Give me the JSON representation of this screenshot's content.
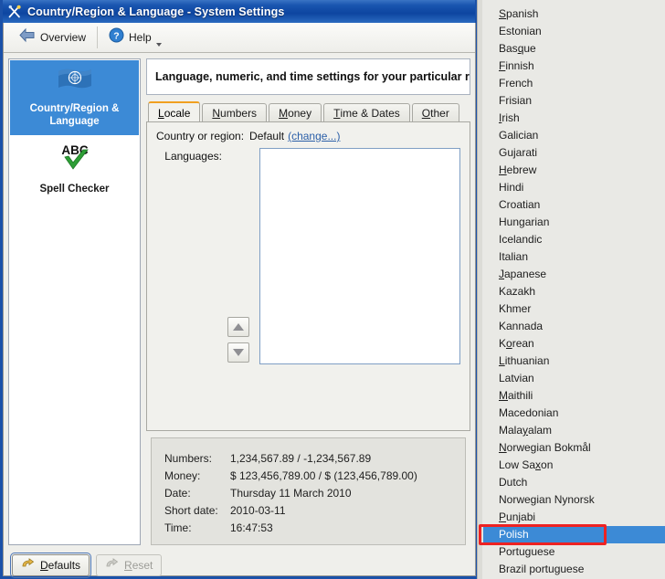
{
  "window": {
    "title": "Country/Region & Language - System Settings",
    "icon": "tools-icon"
  },
  "toolbar": {
    "overview_label_pre": "",
    "overview_label": "Overview",
    "overview_icon": "back-arrow-icon",
    "help_label": "Help",
    "help_icon": "help-circle-icon"
  },
  "sidebar": {
    "items": [
      {
        "label_line1": "Country/Region &",
        "label_line2": "Language",
        "icon": "un-flag-icon",
        "selected": true
      },
      {
        "label_line1": "Spell Checker",
        "label_line2": "",
        "icon": "abc-check-icon",
        "selected": false
      }
    ]
  },
  "main": {
    "header": "Language, numeric, and time settings for your particular region",
    "tabs": [
      {
        "label": "Locale",
        "mnemonic": "L",
        "active": true
      },
      {
        "label": "Numbers",
        "mnemonic": "N",
        "active": false
      },
      {
        "label": "Money",
        "mnemonic": "M",
        "active": false
      },
      {
        "label": "Time & Dates",
        "mnemonic": "T",
        "active": false
      },
      {
        "label": "Other",
        "mnemonic": "O",
        "active": false
      }
    ],
    "country_label": "Country or region:",
    "country_value": "Default",
    "country_change_link": "(change...)",
    "languages_label": "Languages:",
    "languages_items": [],
    "move_up_icon": "triangle-up-icon",
    "move_down_icon": "triangle-down-icon"
  },
  "summary": {
    "rows": [
      {
        "key": "Numbers:",
        "value": "1,234,567.89 / -1,234,567.89"
      },
      {
        "key": "Money:",
        "value": "$ 123,456,789.00 / $ (123,456,789.00)"
      },
      {
        "key": "Date:",
        "value": "Thursday 11 March 2010"
      },
      {
        "key": "Short date:",
        "value": "2010-03-11"
      },
      {
        "key": "Time:",
        "value": "16:47:53"
      }
    ]
  },
  "buttons": {
    "defaults": {
      "label": "Defaults",
      "mnemonic": "D",
      "icon": "undo-arrow-icon",
      "disabled": false
    },
    "reset": {
      "label": "Reset",
      "mnemonic": "R",
      "icon": "reset-arrow-icon",
      "disabled": true
    }
  },
  "dropdown": {
    "highlight_color": "#3c8ad6",
    "annotation_color": "#ee2222",
    "items": [
      {
        "label": "",
        "clipped": true,
        "mnemonic": ""
      },
      {
        "label": "Spanish",
        "mnemonic": "S"
      },
      {
        "label": "Estonian",
        "mnemonic": ""
      },
      {
        "label": "Basque",
        "mnemonic": "q"
      },
      {
        "label": "Finnish",
        "mnemonic": "F"
      },
      {
        "label": "French",
        "mnemonic": ""
      },
      {
        "label": "Frisian",
        "mnemonic": ""
      },
      {
        "label": "Irish",
        "mnemonic": "I"
      },
      {
        "label": "Galician",
        "mnemonic": ""
      },
      {
        "label": "Gujarati",
        "mnemonic": ""
      },
      {
        "label": "Hebrew",
        "mnemonic": "H"
      },
      {
        "label": "Hindi",
        "mnemonic": ""
      },
      {
        "label": "Croatian",
        "mnemonic": ""
      },
      {
        "label": "Hungarian",
        "mnemonic": ""
      },
      {
        "label": "Icelandic",
        "mnemonic": ""
      },
      {
        "label": "Italian",
        "mnemonic": ""
      },
      {
        "label": "Japanese",
        "mnemonic": "J"
      },
      {
        "label": "Kazakh",
        "mnemonic": ""
      },
      {
        "label": "Khmer",
        "mnemonic": ""
      },
      {
        "label": "Kannada",
        "mnemonic": ""
      },
      {
        "label": "Korean",
        "mnemonic": "o"
      },
      {
        "label": "Lithuanian",
        "mnemonic": "L"
      },
      {
        "label": "Latvian",
        "mnemonic": ""
      },
      {
        "label": "Maithili",
        "mnemonic": "M"
      },
      {
        "label": "Macedonian",
        "mnemonic": ""
      },
      {
        "label": "Malayalam",
        "mnemonic": "y"
      },
      {
        "label": "Norwegian Bokmål",
        "mnemonic": "N"
      },
      {
        "label": "Low Saxon",
        "mnemonic": "x"
      },
      {
        "label": "Dutch",
        "mnemonic": ""
      },
      {
        "label": "Norwegian Nynorsk",
        "mnemonic": ""
      },
      {
        "label": "Punjabi",
        "mnemonic": "P"
      },
      {
        "label": "Polish",
        "mnemonic": "",
        "selected": true,
        "annotated": true
      },
      {
        "label": "Portuguese",
        "mnemonic": ""
      },
      {
        "label": "Brazil portuguese",
        "mnemonic": ""
      }
    ]
  }
}
